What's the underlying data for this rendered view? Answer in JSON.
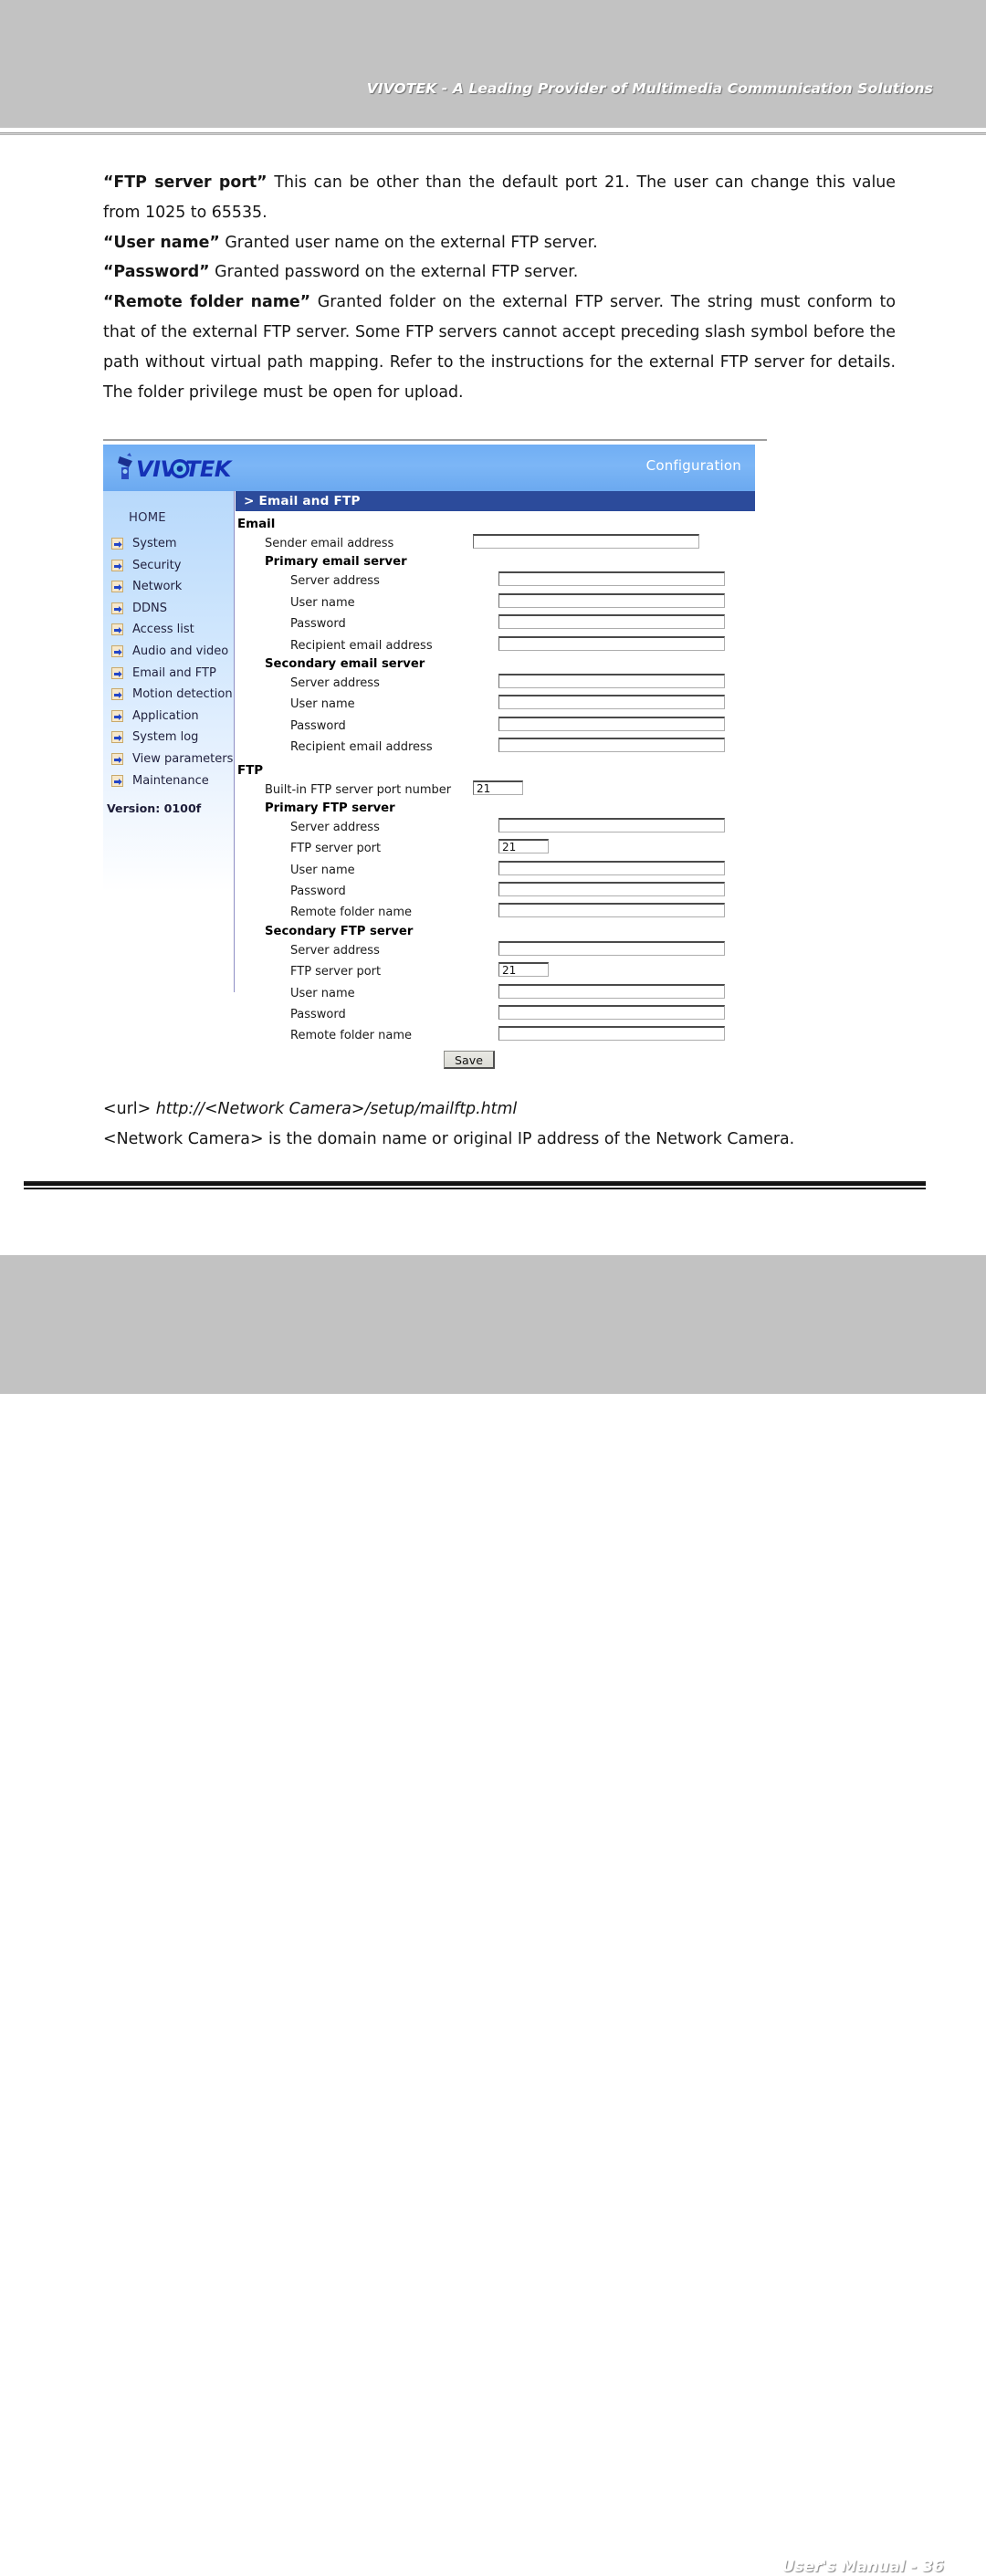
{
  "page": {
    "header_title": "VIVOTEK - A Leading Provider of Multimedia Communication Solutions",
    "footer_title": "User's Manual - 36"
  },
  "body_copy": {
    "p1_bold": "“FTP server port”",
    "p1_rest": " This can be other than the default port 21. The user can change this value from 1025 to 65535.",
    "p2_bold": "“User name”",
    "p2_rest": " Granted user name on the external FTP server.",
    "p3_bold": "“Password”",
    "p3_rest": " Granted password on the external FTP server.",
    "p4_bold": "“Remote folder name”",
    "p4_rest": " Granted folder on the external FTP server. The string must conform to that of the external FTP server. Some FTP servers cannot accept preceding slash symbol before the path without virtual path mapping. Refer to the instructions for the external FTP server for details. The folder privilege must be open for upload."
  },
  "tail": {
    "url_label": "<url> ",
    "url_value": "http://<Network Camera>/setup/mailftp.html",
    "note": "<Network Camera> is the domain name or original IP address of the Network Camera."
  },
  "app": {
    "brand": "VIVOTEK",
    "mode_label": "Configuration",
    "breadcrumb": "> Email and FTP",
    "nav": {
      "home_label": "HOME",
      "version": "Version: 0100f",
      "items": [
        {
          "label": "System"
        },
        {
          "label": "Security"
        },
        {
          "label": "Network"
        },
        {
          "label": "DDNS"
        },
        {
          "label": "Access list"
        },
        {
          "label": "Audio and video"
        },
        {
          "label": "Email and FTP"
        },
        {
          "label": "Motion detection"
        },
        {
          "label": "Application"
        },
        {
          "label": "System log"
        },
        {
          "label": "View parameters"
        },
        {
          "label": "Maintenance"
        }
      ]
    },
    "email_section": {
      "title": "Email",
      "sender_label": "Sender email address",
      "sender_value": "",
      "primary_title": "Primary email server",
      "primary_fields": [
        {
          "label": "Server address",
          "value": ""
        },
        {
          "label": "User name",
          "value": ""
        },
        {
          "label": "Password",
          "value": ""
        },
        {
          "label": "Recipient email address",
          "value": ""
        }
      ],
      "secondary_title": "Secondary email server",
      "secondary_fields": [
        {
          "label": "Server address",
          "value": ""
        },
        {
          "label": "User name",
          "value": ""
        },
        {
          "label": "Password",
          "value": ""
        },
        {
          "label": "Recipient email address",
          "value": ""
        }
      ]
    },
    "ftp_section": {
      "title": "FTP",
      "builtin_label": "Built-in FTP server port number",
      "builtin_value": "21",
      "primary_title": "Primary FTP server",
      "primary_fields": [
        {
          "label": "Server address",
          "value": "",
          "size": "wide"
        },
        {
          "label": "FTP server port",
          "value": "21",
          "size": "narrow"
        },
        {
          "label": "User name",
          "value": "",
          "size": "wide"
        },
        {
          "label": "Password",
          "value": "",
          "size": "wide"
        },
        {
          "label": "Remote folder name",
          "value": "",
          "size": "wide"
        }
      ],
      "secondary_title": "Secondary FTP server",
      "secondary_fields": [
        {
          "label": "Server address",
          "value": "",
          "size": "wide"
        },
        {
          "label": "FTP server port",
          "value": "21",
          "size": "narrow"
        },
        {
          "label": "User name",
          "value": "",
          "size": "wide"
        },
        {
          "label": "Password",
          "value": "",
          "size": "wide"
        },
        {
          "label": "Remote folder name",
          "value": "",
          "size": "wide"
        }
      ],
      "save_label": "Save"
    }
  },
  "colors": {
    "band": "#c2c2c2",
    "app_header_blue": "#7cb6f6",
    "crumb_blue": "#2c4b9b",
    "nav_gradient_top": "#b8d9fb",
    "bullet_fill": "#f6e8cc",
    "bullet_border": "#c9a96a",
    "arrow_blue": "#2246c8"
  }
}
